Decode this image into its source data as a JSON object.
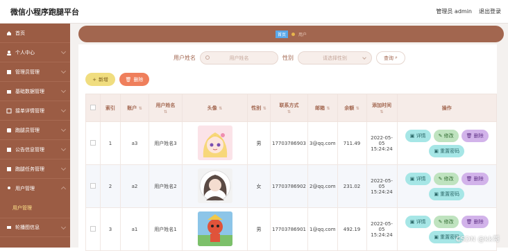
{
  "app": {
    "title": "微信小程序跑腿平台"
  },
  "header": {
    "admin_label": "管理员 admin",
    "logout_label": "退出登录"
  },
  "sidebar": {
    "items": [
      {
        "label": "首页",
        "icon": "home-icon"
      },
      {
        "label": "个人中心",
        "icon": "user-icon"
      },
      {
        "label": "管理员管理",
        "icon": "admin-icon"
      },
      {
        "label": "基础数据管理",
        "icon": "data-icon"
      },
      {
        "label": "接单详情管理",
        "icon": "order-icon"
      },
      {
        "label": "跑腿员管理",
        "icon": "runner-icon"
      },
      {
        "label": "公告信息管理",
        "icon": "notice-icon"
      },
      {
        "label": "跑腿任务管理",
        "icon": "task-icon"
      },
      {
        "label": "用户管理",
        "icon": "users-icon"
      }
    ],
    "sub_active": "用户管理",
    "last_item": {
      "label": "轮播图信息",
      "icon": "carousel-icon"
    }
  },
  "breadcrumb": {
    "home": "首页",
    "current": "用户"
  },
  "search": {
    "name_label": "用户姓名",
    "name_placeholder": "用户姓名",
    "gender_label": "性别",
    "gender_placeholder": "请选择性别",
    "query_label": "查询"
  },
  "actions": {
    "add_label": "新增",
    "delete_label": "删除"
  },
  "table": {
    "headers": [
      "索引",
      "账户",
      "用户姓名",
      "头像",
      "性别",
      "联系方式",
      "邮箱",
      "余额",
      "添加时间",
      "操作"
    ],
    "rows": [
      {
        "index": "1",
        "account": "a3",
        "name": "用户姓名3",
        "gender": "男",
        "phone": "17703786903",
        "email": "3@qq.com",
        "balance": "711.49",
        "time": "2022-05-05 15:24:24"
      },
      {
        "index": "2",
        "account": "a2",
        "name": "用户姓名2",
        "gender": "女",
        "phone": "17703786902",
        "email": "2@qq.com",
        "balance": "231.02",
        "time": "2022-05-05 15:24:24"
      },
      {
        "index": "3",
        "account": "a1",
        "name": "用户姓名1",
        "gender": "男",
        "phone": "17703786901",
        "email": "1@qq.com",
        "balance": "492.19",
        "time": "2022-05-05 15:24:24"
      }
    ],
    "ops": {
      "detail": "详情",
      "edit": "修改",
      "delete": "删除",
      "reset": "重置密码"
    }
  },
  "watermark": "CSDN @kk哥",
  "colors": {
    "sidebar": "#9b5c44",
    "accent": "#a2664f",
    "add": "#f0dd7f",
    "del": "#ef7f5c"
  }
}
